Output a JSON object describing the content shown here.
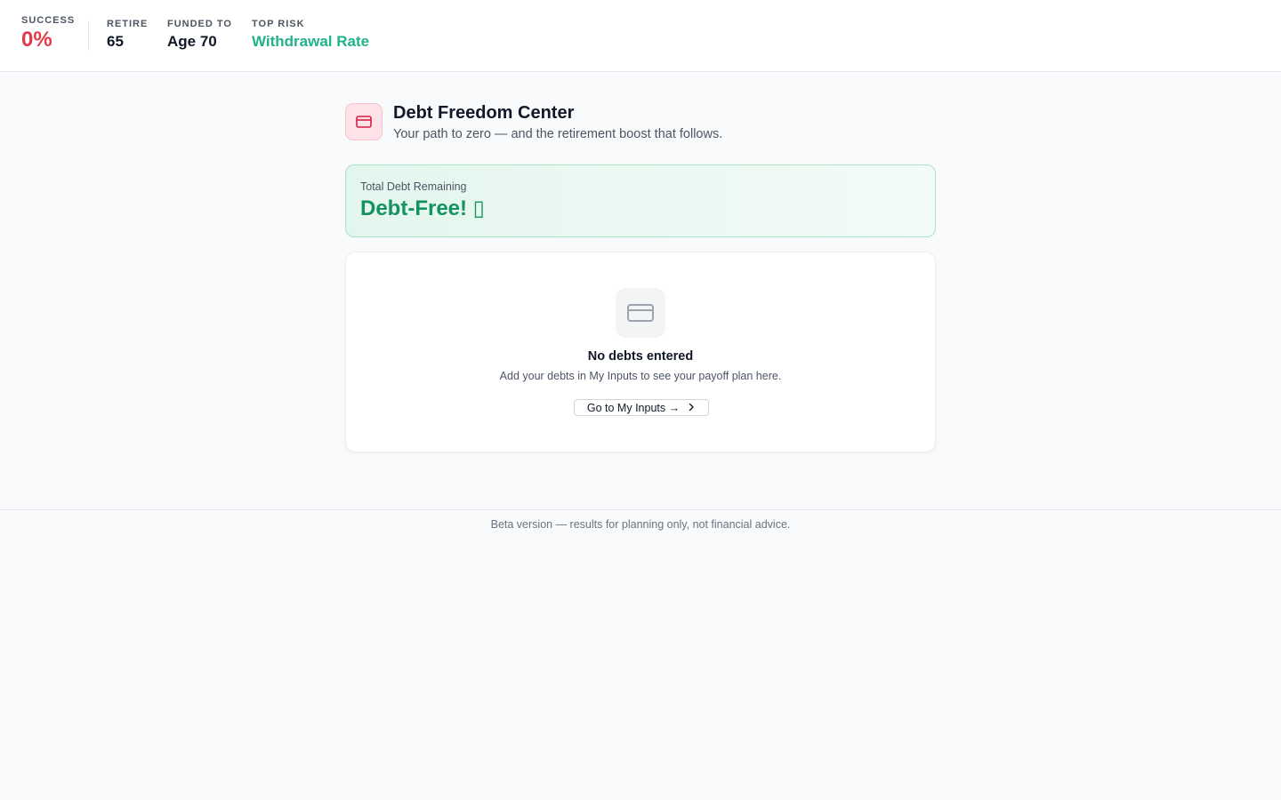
{
  "stats": {
    "success": {
      "label": "SUCCESS",
      "value": "0%",
      "color": "#e23a4a"
    },
    "retire": {
      "label": "RETIRE",
      "value": "65",
      "color": "#111827"
    },
    "funded_to": {
      "label": "FUNDED TO",
      "value": "Age 70",
      "color": "#111827"
    },
    "top_risk": {
      "label": "TOP RISK",
      "value": "Withdrawal Rate",
      "color": "#1fb38a"
    }
  },
  "header": {
    "icon": "credit-card-icon",
    "title": "Debt Freedom Center",
    "subtitle": "Your path to zero — and the retirement boost that follows."
  },
  "total_debt": {
    "label": "Total Debt Remaining",
    "value": "Debt-Free! ▯"
  },
  "empty_state": {
    "icon": "credit-card-icon",
    "title": "No debts entered",
    "description": "Add your debts in My Inputs to see your payoff plan here.",
    "button_label": "Go to My Inputs →"
  },
  "footer": {
    "text": "Beta version — results for planning only, not financial advice."
  },
  "colors": {
    "accent_success": "#e23a4a",
    "accent_risk": "#1fb38a",
    "debt_free": "#15935f",
    "header_icon": "#d61f45"
  }
}
